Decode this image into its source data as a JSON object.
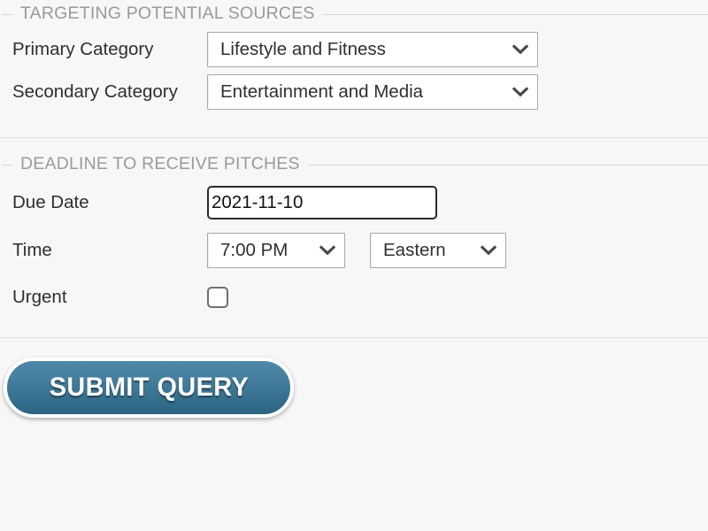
{
  "background_color": "#f7f7f7",
  "sections": [
    {
      "legend": "TARGETING POTENTIAL SOURCES",
      "rows": [
        {
          "label": "Primary Category",
          "control": "select",
          "value": "Lifestyle and Fitness"
        },
        {
          "label": "Secondary Category",
          "control": "select",
          "value": "Entertainment and Media"
        }
      ]
    },
    {
      "legend": "DEADLINE TO RECEIVE PITCHES",
      "rows": [
        {
          "label": "Due Date",
          "control": "text-input",
          "value": "2021-11-10",
          "placeholder": "YYYY-MM-DD"
        },
        {
          "label": "Time",
          "control": "select-pair",
          "value": "7:00 PM",
          "value_zone": "Eastern"
        },
        {
          "label": "Urgent",
          "control": "checkbox",
          "checked": false
        }
      ]
    }
  ],
  "footer": {
    "submit_label": "SUBMIT QUERY",
    "submit_color": "#3a7694",
    "submit_text_color": "#ffffff"
  },
  "icons": {
    "chevron_down": "chevron-down-icon"
  },
  "colors": {
    "legend_text": "#9a9a9a",
    "legend_rule": "#d6d6d6",
    "label_text": "#2f2f2f",
    "field_border": "#a8a8a8",
    "input_border": "#2b2b2b",
    "divider": "#dcdcdc"
  }
}
